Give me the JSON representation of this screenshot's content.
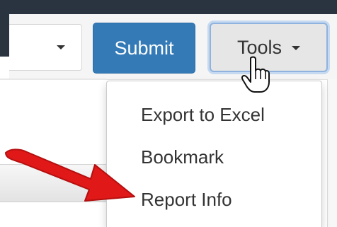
{
  "toolbar": {
    "submit_label": "Submit",
    "tools_label": "Tools"
  },
  "tools_menu": {
    "items": [
      {
        "label": "Export to Excel"
      },
      {
        "label": "Bookmark"
      },
      {
        "label": "Report Info"
      }
    ]
  },
  "colors": {
    "primary_button": "#337ab7",
    "annotation_arrow": "#e01818"
  },
  "icons": {
    "cursor": "hand-pointer-icon",
    "select_caret": "chevron-down-icon",
    "tools_caret": "chevron-down-icon",
    "annotation": "red-arrow-annotation"
  }
}
